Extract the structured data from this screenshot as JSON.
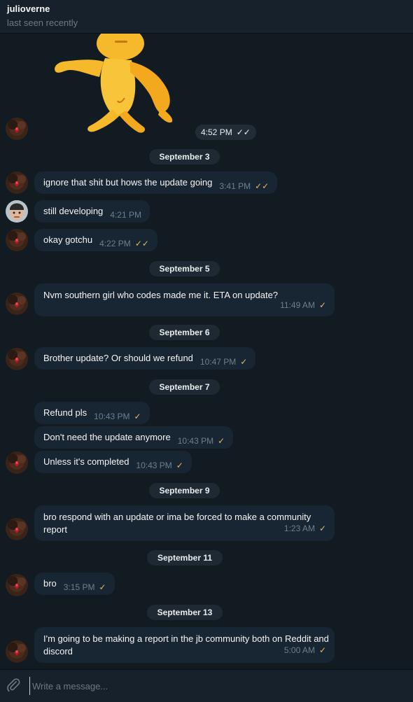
{
  "header": {
    "contact_name": "julioverne",
    "status": "last seen recently"
  },
  "sticker": {
    "description_icon": "walking-cartoon-man-sticker",
    "time": "4:52 PM",
    "read": "double-check"
  },
  "dates": {
    "d1": "September 3",
    "d2": "September 5",
    "d3": "September 6",
    "d4": "September 7",
    "d5": "September 9",
    "d6": "September 11",
    "d7": "September 13"
  },
  "messages": [
    {
      "text": "ignore that shit but hows the update going",
      "time": "3:41 PM",
      "check": "✓✓"
    },
    {
      "text": "still developing",
      "time": "4:21 PM",
      "check": ""
    },
    {
      "text": "okay gotchu",
      "time": "4:22 PM",
      "check": "✓✓"
    },
    {
      "text": "Nvm southern girl who codes made me it. ETA on update?",
      "time": "11:49 AM",
      "check": "✓"
    },
    {
      "text": "Brother update? Or should we refund",
      "time": "10:47 PM",
      "check": "✓"
    },
    {
      "text": "Refund pls",
      "time": "10:43 PM",
      "check": "✓"
    },
    {
      "text": "Don't need the update anymore",
      "time": "10:43 PM",
      "check": "✓"
    },
    {
      "text": "Unless it's completed",
      "time": "10:43 PM",
      "check": "✓"
    },
    {
      "text": "bro respond with an update or ima be forced to make a community report",
      "time": "1:23 AM",
      "check": "✓"
    },
    {
      "text": "bro",
      "time": "3:15 PM",
      "check": "✓"
    },
    {
      "text": "I'm going to be making a report in the jb community both on Reddit and discord",
      "time": "5:00 AM",
      "check": "✓"
    }
  ],
  "composer": {
    "placeholder": "Write a message..."
  },
  "colors": {
    "background": "#121a22",
    "header": "#17212b",
    "bubble": "#182533",
    "check": "#e8b75c",
    "muted": "#6d7883"
  }
}
